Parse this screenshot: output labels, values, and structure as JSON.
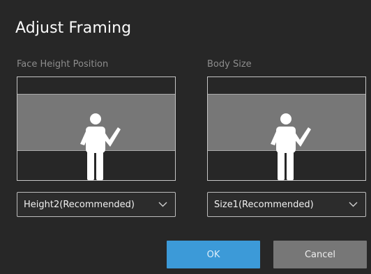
{
  "dialog": {
    "title": "Adjust Framing"
  },
  "face_height": {
    "label": "Face Height Position",
    "selected": "Height2(Recommended)",
    "chevron_icon": "chevron-down-icon",
    "figure_icon": "person-waving-icon"
  },
  "body_size": {
    "label": "Body Size",
    "selected": "Size1(Recommended)",
    "chevron_icon": "chevron-down-icon",
    "figure_icon": "person-waving-icon"
  },
  "buttons": {
    "ok_label": "OK",
    "cancel_label": "Cancel"
  },
  "colors": {
    "background": "#272727",
    "band": "#777777",
    "ok_accent": "#3c9ad8",
    "cancel": "#777777"
  }
}
